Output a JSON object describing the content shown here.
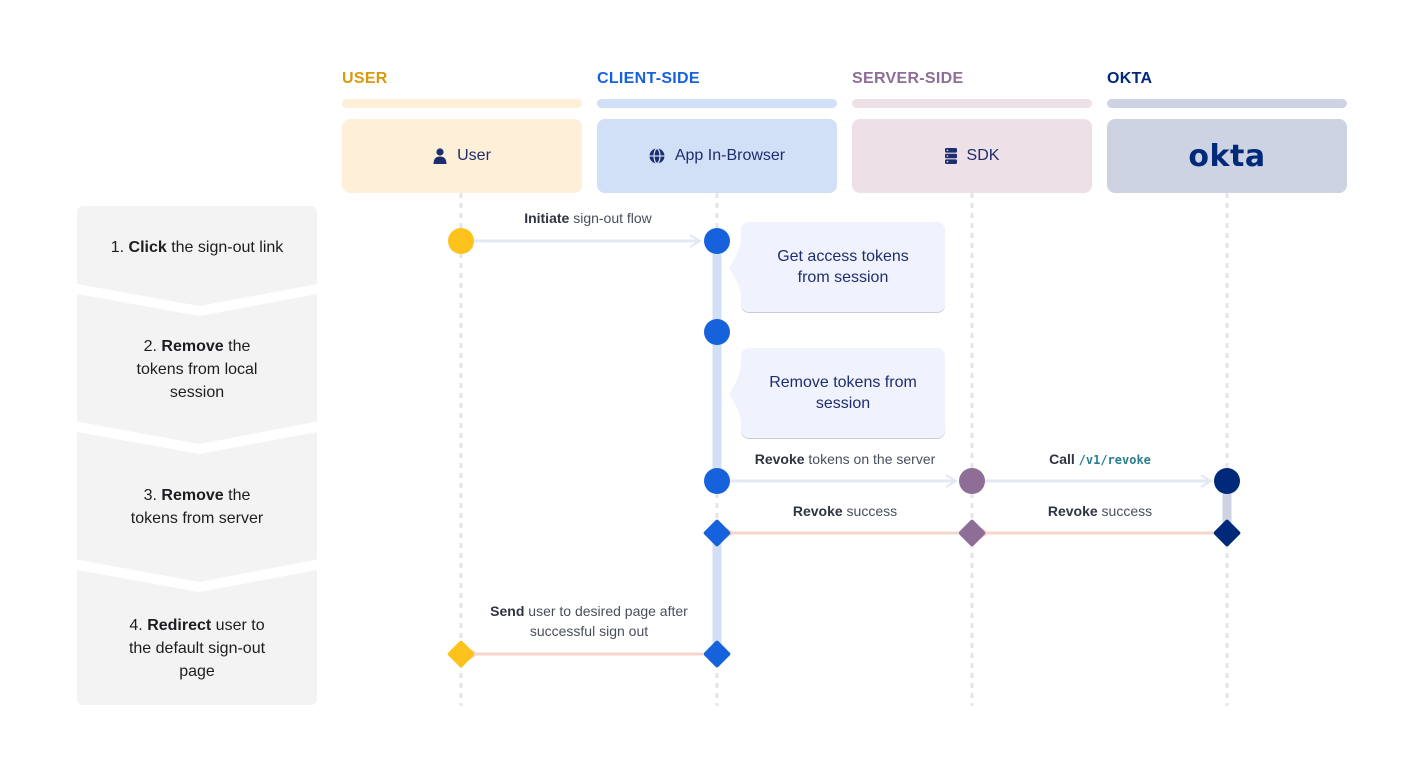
{
  "colors": {
    "user": "#d89a0e",
    "client": "#1662dd",
    "server": "#8e6d96",
    "okta": "#00297a",
    "user_light": "#fef0d8",
    "client_light": "#d1dff7",
    "server_light": "#ede0e6",
    "okta_light": "#cdd3e2",
    "request_arrow": "#e2e8f4",
    "response_arrow": "#f6d5cc",
    "step_bg": "#f3f3f3"
  },
  "lanes": [
    {
      "id": "user",
      "title": "USER",
      "actor": "User",
      "icon": "person-icon"
    },
    {
      "id": "client",
      "title": "CLIENT-SIDE",
      "actor": "App In-Browser",
      "icon": "globe-icon"
    },
    {
      "id": "server",
      "title": "SERVER-SIDE",
      "actor": "SDK",
      "icon": "server-icon"
    },
    {
      "id": "okta",
      "title": "OKTA",
      "actor": "okta",
      "icon": "okta-logo"
    }
  ],
  "steps": [
    {
      "num": "1.",
      "bold": "Click",
      "rest": " the sign-out link"
    },
    {
      "num": "2.",
      "bold": "Remove",
      "rest": " the tokens from local session"
    },
    {
      "num": "3.",
      "bold": "Remove",
      "rest": " the tokens from server"
    },
    {
      "num": "4.",
      "bold": "Redirect",
      "rest": " user to the default sign-out page"
    }
  ],
  "messages": {
    "m1": {
      "bold": "Initiate",
      "rest": " sign-out flow"
    },
    "m2": {
      "bold": "Revoke",
      "rest": " tokens on the server"
    },
    "m3": {
      "bold": "Call",
      "code": "/v1/revoke"
    },
    "m4": {
      "bold": "Revoke",
      "rest": " success"
    },
    "m5": {
      "bold": "Revoke",
      "rest": " success"
    },
    "m6": {
      "bold": "Send",
      "rest": " user to desired page after successful sign out"
    }
  },
  "notes": {
    "n1": "Get access tokens from session",
    "n2": "Remove tokens from session"
  }
}
